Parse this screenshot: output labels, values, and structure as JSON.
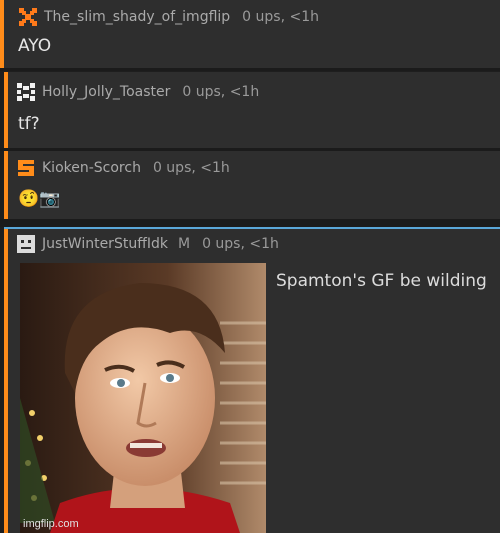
{
  "comments": [
    {
      "username": "The_slim_shady_of_imgflip",
      "meta": "0 ups, <1h",
      "text": "AYO"
    },
    {
      "username": "Holly_Jolly_Toaster",
      "meta": "0 ups, <1h",
      "text": "tf?"
    },
    {
      "username": "Kioken-Scorch",
      "meta": "0 ups, <1h",
      "text": "🤨📷"
    },
    {
      "username": "JustWinterStuffIdk",
      "badge": "M",
      "meta": "0 ups, <1h",
      "caption": "Spamton's GF be wilding"
    }
  ],
  "watermark": "imgflip.com",
  "colors": {
    "accent": "#ff8c1a",
    "panel": "#2e2e2e",
    "text": "#e6e6e6",
    "muted": "#aaaaaa"
  },
  "icons": [
    "x-pattern-avatar",
    "checker-avatar",
    "s-letter-avatar",
    "face-avatar"
  ]
}
